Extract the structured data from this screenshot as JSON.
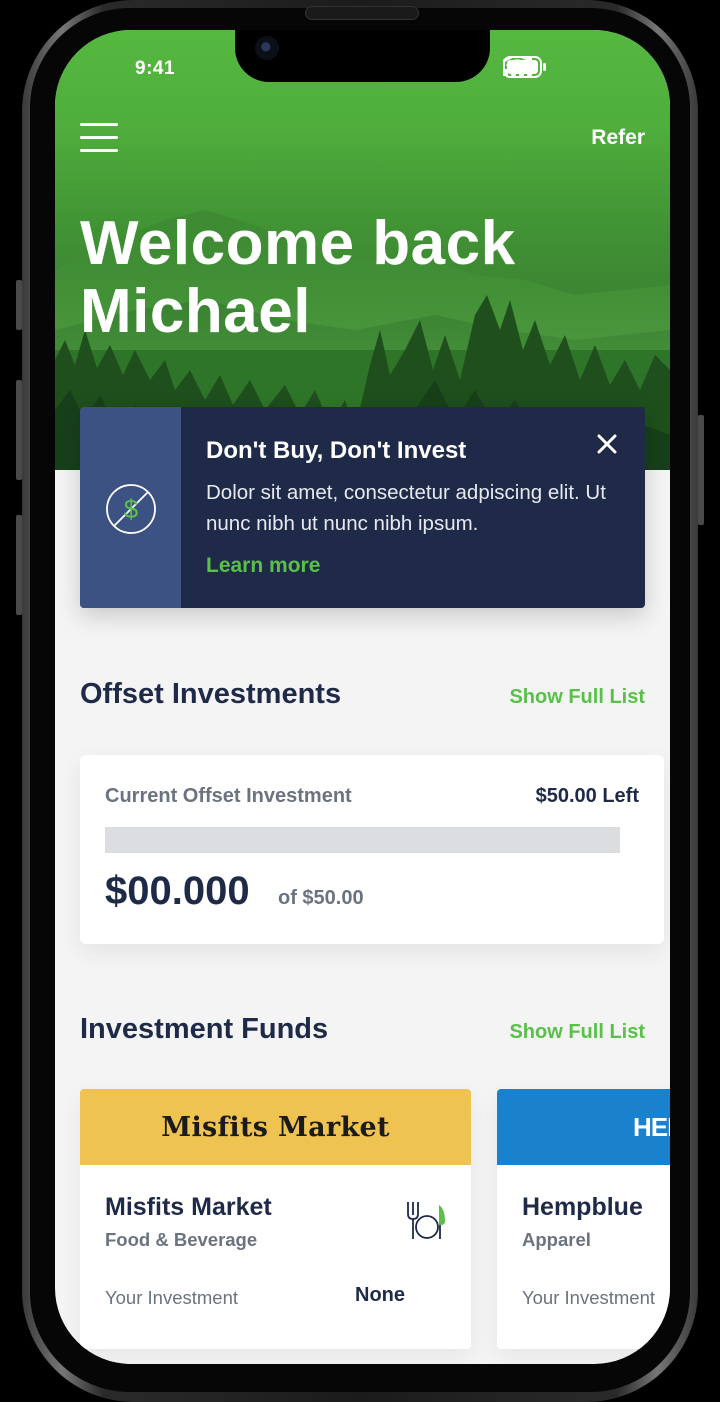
{
  "status_bar": {
    "time": "9:41"
  },
  "header": {
    "refer_label": "Refer"
  },
  "hero": {
    "greeting": "Welcome back Michael"
  },
  "promo": {
    "title": "Don't Buy, Don't Invest",
    "body": "Dolor sit amet, consectetur adpiscing elit. Ut nunc nibh ut nunc nibh ipsum.",
    "link": "Learn more",
    "icon": "no-dollar-icon"
  },
  "offset": {
    "section_title": "Offset Investments",
    "show_list": "Show Full List",
    "label": "Current Offset Investment",
    "left": "$50.00 Left",
    "amount": "$00.000",
    "of": "of $50.00",
    "progress": 0
  },
  "funds": {
    "section_title": "Investment Funds",
    "show_list": "Show Full List",
    "items": [
      {
        "logo": "Misfits Market",
        "name": "Misfits Market",
        "category": "Food & Beverage",
        "investment_label": "Your Investment",
        "investment_value": "None",
        "banner_color": "#efc352",
        "icon": "utensils-icon"
      },
      {
        "logo": "HEM",
        "name": "Hempblue",
        "category": "Apparel",
        "investment_label": "Your Investment",
        "banner_color": "#1a82cd"
      }
    ]
  },
  "colors": {
    "accent": "#5ac04a",
    "navy": "#1e2a47"
  }
}
